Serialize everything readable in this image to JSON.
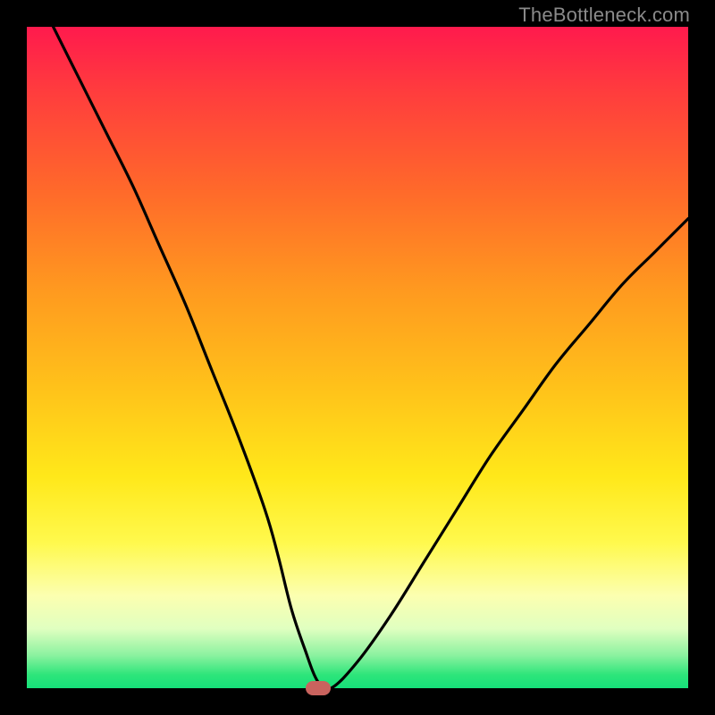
{
  "watermark": "TheBottleneck.com",
  "chart_data": {
    "type": "line",
    "title": "",
    "xlabel": "",
    "ylabel": "",
    "xlim": [
      0,
      100
    ],
    "ylim": [
      0,
      100
    ],
    "grid": false,
    "legend": false,
    "series": [
      {
        "name": "curve",
        "x": [
          4,
          8,
          12,
          16,
          20,
          24,
          28,
          32,
          36,
          38,
          40,
          42,
          44,
          46,
          50,
          55,
          60,
          65,
          70,
          75,
          80,
          85,
          90,
          95,
          100
        ],
        "y": [
          100,
          92,
          84,
          76,
          67,
          58,
          48,
          38,
          27,
          20,
          12,
          6,
          1,
          0,
          4,
          11,
          19,
          27,
          35,
          42,
          49,
          55,
          61,
          66,
          71
        ]
      }
    ],
    "marker": {
      "x": 44,
      "y": 0,
      "color": "#c9635e"
    },
    "background_gradient": {
      "top": "#ff1a4d",
      "mid": "#ffe81a",
      "bottom": "#16e07a"
    }
  }
}
